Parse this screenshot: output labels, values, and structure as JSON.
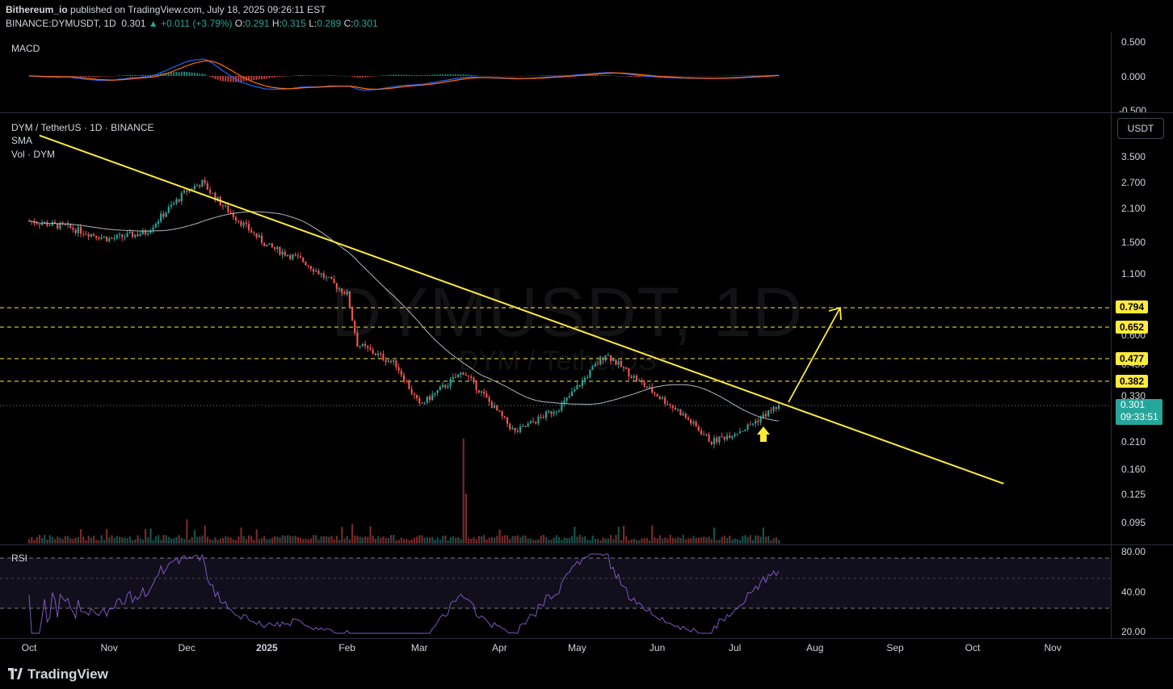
{
  "header": {
    "author": "Bithereum_io",
    "published_text": " published on TradingView.com, July 18, 2025 09:26:11 EST",
    "symbol_line": "BINANCE:DYMUSDT, 1D",
    "price": "0.301",
    "change": "▲ +0.011 (+3.79%)",
    "o_label": "O:",
    "o_value": "0.291",
    "h_label": "H:",
    "h_value": "0.315",
    "l_label": "L:",
    "l_value": "0.289",
    "c_label": "C:",
    "c_value": "0.301"
  },
  "macd_pane": {
    "title": "MACD",
    "axis": [
      "0.500",
      "0.000",
      "-0.500"
    ]
  },
  "main_pane": {
    "title": "DYM / TetherUS · 1D · BINANCE",
    "sma_label": "SMA",
    "vol_label": "Vol · DYM",
    "currency_button": "USDT",
    "watermark_symbol": "DYMUSDT, 1D",
    "watermark_name": "DYM / TetherUS",
    "price_axis": [
      "3.500",
      "2.700",
      "2.100",
      "1.500",
      "1.100",
      "0.600",
      "0.450",
      "0.330",
      "0.210",
      "0.160",
      "0.125",
      "0.095"
    ],
    "levels": [
      "0.794",
      "0.652",
      "0.477",
      "0.382"
    ],
    "last_price": "0.301",
    "countdown": "09:33:51"
  },
  "rsi_pane": {
    "title": "RSI",
    "axis": [
      "80.00",
      "40.00",
      "20.00"
    ]
  },
  "time_axis": [
    "Oct",
    "Nov",
    "Dec",
    "2025",
    "Feb",
    "Mar",
    "Apr",
    "May",
    "Jun",
    "Jul",
    "Aug",
    "Sep",
    "Oct",
    "Nov"
  ],
  "footer": {
    "brand": "TradingView"
  },
  "colors": {
    "up": "#26a69a",
    "down": "#ef5350",
    "trendline": "#ffeb3b",
    "sma": "#b2b5be",
    "macd": "#2962ff",
    "signal": "#ff6d00",
    "rsi": "#7e57c2"
  },
  "chart_data": {
    "type": "candlestick",
    "symbol": "DYMUSDT",
    "timeframe": "1D",
    "price_scale": "log",
    "key_levels": [
      0.794,
      0.652,
      0.477,
      0.382
    ],
    "last": 0.301,
    "approx_closes": [
      {
        "date": "2024-10-01",
        "close": 1.85
      },
      {
        "date": "2024-10-15",
        "close": 1.75
      },
      {
        "date": "2024-11-01",
        "close": 1.55
      },
      {
        "date": "2024-11-15",
        "close": 1.65
      },
      {
        "date": "2024-12-01",
        "close": 2.5
      },
      {
        "date": "2024-12-07",
        "close": 2.7
      },
      {
        "date": "2024-12-15",
        "close": 2.15
      },
      {
        "date": "2025-01-01",
        "close": 1.45
      },
      {
        "date": "2025-01-15",
        "close": 1.25
      },
      {
        "date": "2025-02-01",
        "close": 0.9
      },
      {
        "date": "2025-02-05",
        "close": 0.55
      },
      {
        "date": "2025-02-20",
        "close": 0.45
      },
      {
        "date": "2025-03-01",
        "close": 0.3
      },
      {
        "date": "2025-03-18",
        "close": 0.42
      },
      {
        "date": "2025-04-07",
        "close": 0.23
      },
      {
        "date": "2025-04-25",
        "close": 0.3
      },
      {
        "date": "2025-05-12",
        "close": 0.5
      },
      {
        "date": "2025-05-25",
        "close": 0.38
      },
      {
        "date": "2025-06-10",
        "close": 0.28
      },
      {
        "date": "2025-06-22",
        "close": 0.21
      },
      {
        "date": "2025-07-05",
        "close": 0.24
      },
      {
        "date": "2025-07-18",
        "close": 0.301
      }
    ],
    "trendline": [
      {
        "date": "2024-10-05",
        "price": 4.3
      },
      {
        "date": "2025-10-13",
        "price": 0.139
      }
    ]
  }
}
